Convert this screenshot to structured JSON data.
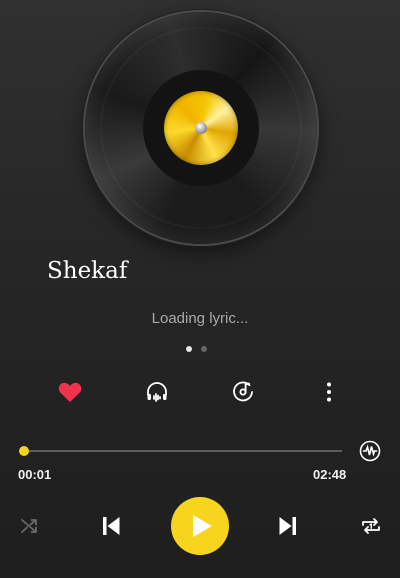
{
  "track": {
    "title": "Shekaf"
  },
  "lyrics": {
    "status": "Loading lyric..."
  },
  "pager": {
    "pages": 2,
    "active": 0
  },
  "actions": {
    "favorite_icon": "heart-icon",
    "headphones_icon": "headphones-icon",
    "disc_icon": "music-disc-icon",
    "more_icon": "more-vertical-icon"
  },
  "progress": {
    "elapsed": "00:01",
    "total": "02:48",
    "fraction": 0.006
  },
  "controls": {
    "shuffle_icon": "shuffle-icon",
    "previous_icon": "skip-previous-icon",
    "play_icon": "play-icon",
    "next_icon": "skip-next-icon",
    "repeat_icon": "repeat-one-icon"
  },
  "colors": {
    "accent": "#f7d51d",
    "favorite": "#f0334a",
    "background": "#282828"
  }
}
